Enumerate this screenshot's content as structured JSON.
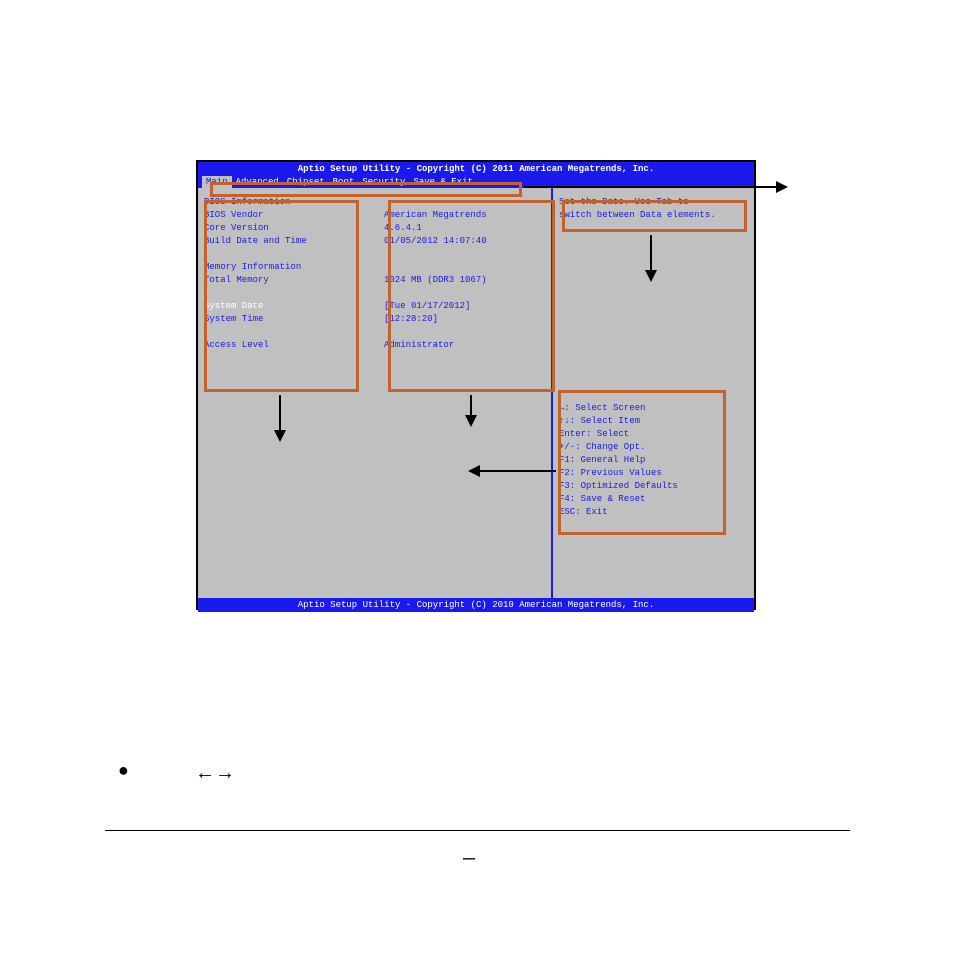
{
  "bios": {
    "title_top": "Aptio Setup Utility - Copyright (C) 2011 American Megatrends, Inc.",
    "menu": {
      "items": [
        {
          "label": "Main"
        },
        {
          "label": "Advanced"
        },
        {
          "label": "Chipset"
        },
        {
          "label": "Boot"
        },
        {
          "label": "Security"
        },
        {
          "label": "Save & Exit"
        }
      ]
    },
    "left": {
      "bios_info_header": "BIOS Information",
      "vendor_label": "BIOS Vendor",
      "vendor_value": "American Megatrends",
      "core_label": "Core Version",
      "core_value": "4.6.4.1",
      "build_label": "Build Date and Time",
      "build_value": "01/05/2012 14:07:40",
      "mem_header": "Memory Information",
      "mem_label": "Total Memory",
      "mem_value": "1024 MB (DDR3 1067)",
      "date_label": "System Date",
      "date_value": "[Tue 01/17/2012]",
      "time_label": "System Time",
      "time_value": "[12:28:20]",
      "access_label": "Access Level",
      "access_value": "Administrator"
    },
    "right": {
      "help1": "Set the Date. Use Tab to",
      "help2": "switch between Data elements.",
      "keys": {
        "k1": "↔: Select Screen",
        "k2": "↑↓: Select Item",
        "k3": "Enter: Select",
        "k4": "+/-: Change Opt.",
        "k5": "F1: General Help",
        "k6": "F2: Previous Values",
        "k7": "F3: Optimized Defaults",
        "k8": "F4: Save & Reset",
        "k9": "ESC: Exit"
      }
    },
    "footer": "Aptio Setup Utility - Copyright (C) 2010 American Megatrends, Inc."
  },
  "doc": {
    "bullet": "●",
    "arrows": "←→",
    "dash": "—"
  }
}
